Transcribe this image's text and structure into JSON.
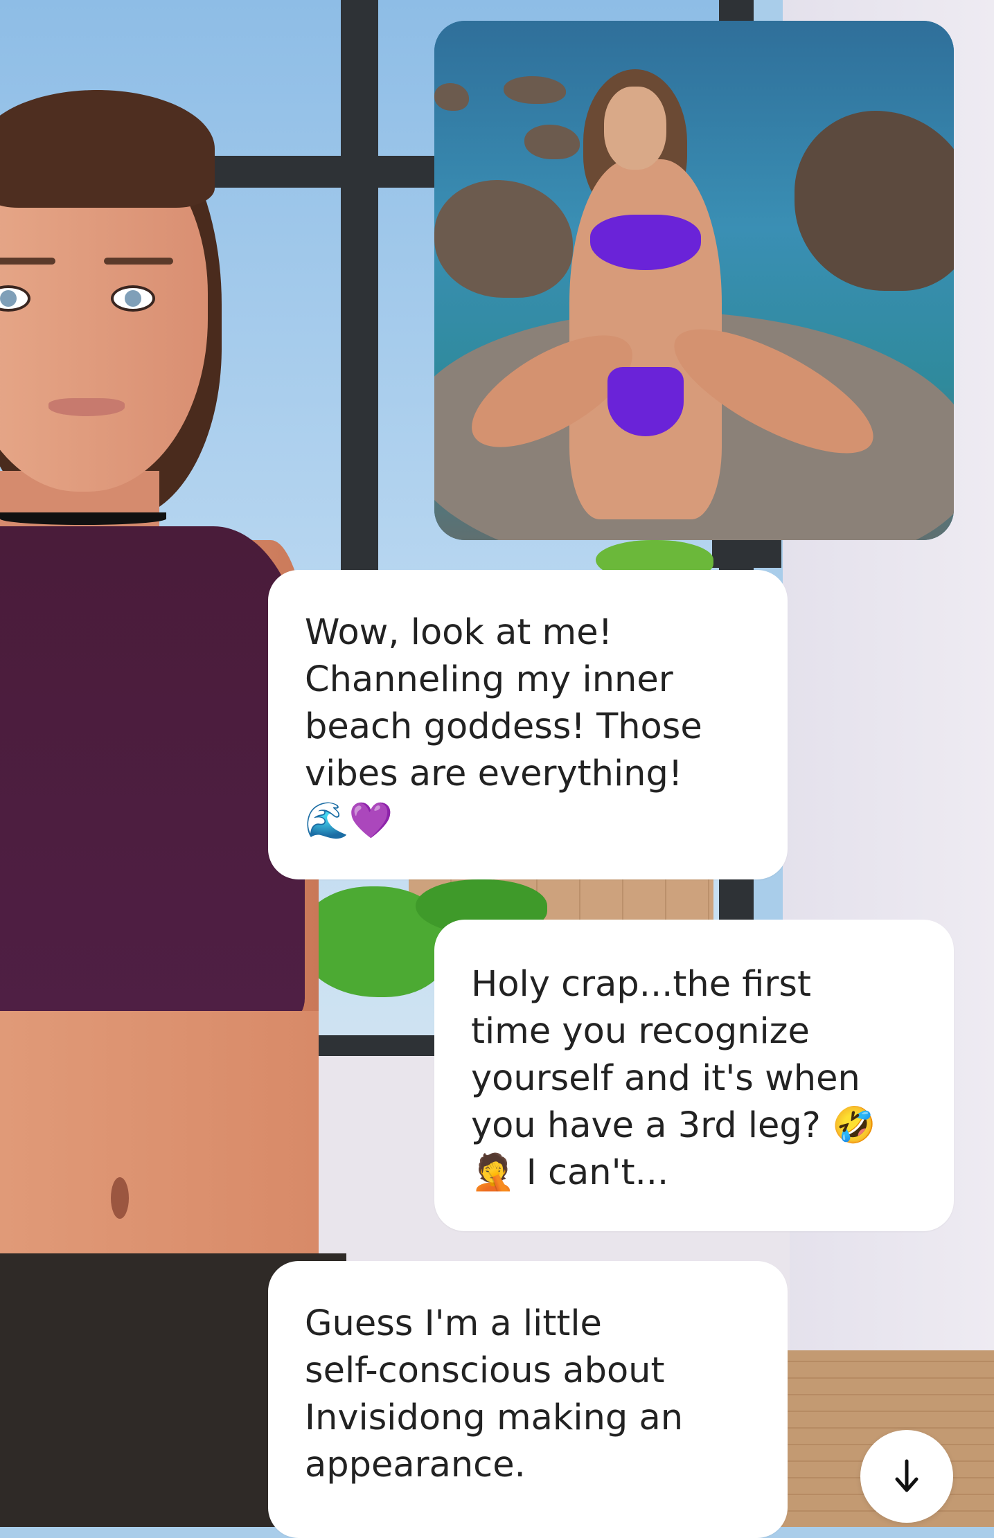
{
  "photo": {
    "description_icon": "image-icon"
  },
  "messages": [
    {
      "text": "Wow, look at me!\nChanneling my inner\nbeach goddess! Those\nvibes are everything!\n🌊💜"
    },
    {
      "text": "Holy crap...the first\ntime you recognize\nyourself and it's when\nyou have a 3rd leg? 🤣\n🤦 I can't..."
    },
    {
      "text": "Guess I'm a little\nself-conscious about\nInvisidong making an\nappearance."
    }
  ],
  "scroll_button": {
    "icon": "arrow-down-icon",
    "glyph": "↓"
  },
  "colors": {
    "bubble": "#ffffff",
    "text": "#222222",
    "top": "#4f1f44",
    "bikini": "#6a23d8"
  }
}
